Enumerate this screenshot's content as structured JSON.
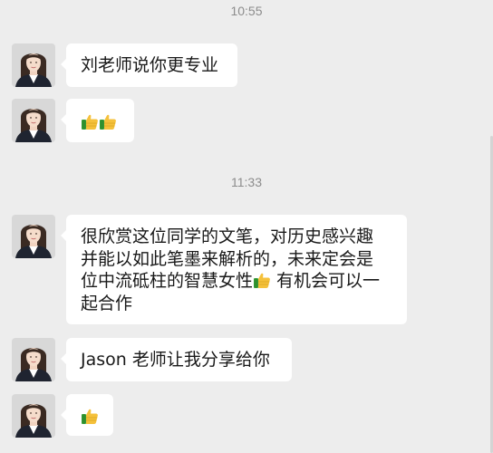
{
  "timestamps": [
    "10:55",
    "11:33"
  ],
  "messages": [
    {
      "sender": "avatar",
      "text": "刘老师说你更专业"
    },
    {
      "sender": "avatar",
      "emoji": "thumbs-up-icon",
      "count": 2
    },
    {
      "sender": "avatar",
      "lines": [
        "很欣赏这位同学的文笔，对历史感兴趣",
        "并能以如此笔墨来解析的，未来定会是",
        "位中流砥柱的智慧女性",
        " 有机会可以一",
        "起合作"
      ]
    },
    {
      "sender": "avatar",
      "text": "Jason 老师让我分享给你"
    },
    {
      "sender": "avatar",
      "emoji": "thumbs-up-icon",
      "count": 1
    }
  ],
  "colors": {
    "background": "#ededed",
    "bubble": "#ffffff",
    "text": "#191919",
    "timestamp": "#8c8c8c"
  }
}
